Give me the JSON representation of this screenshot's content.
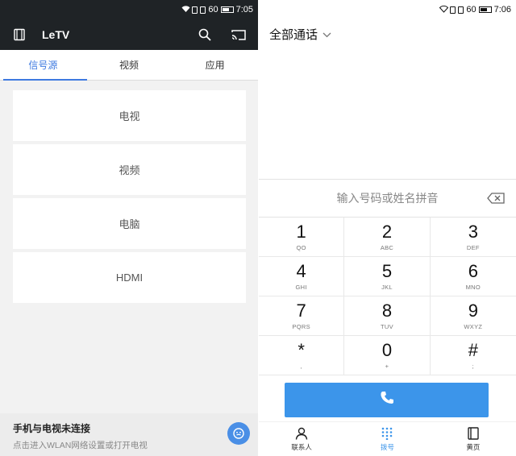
{
  "left": {
    "status": {
      "signal_label": "60",
      "time": "7:05"
    },
    "app_title": "LeTV",
    "tabs": [
      "信号源",
      "视频",
      "应用"
    ],
    "sources": [
      "电视",
      "视频",
      "电脑",
      "HDMI"
    ],
    "connect": {
      "title": "手机与电视未连接",
      "subtitle": "点击进入WLAN网络设置或打开电视"
    }
  },
  "right": {
    "status": {
      "signal_label": "60",
      "time": "7:06"
    },
    "filter_label": "全部通话",
    "number_placeholder": "输入号码或姓名拼音",
    "keys": [
      {
        "digit": "1",
        "letters": "QO"
      },
      {
        "digit": "2",
        "letters": "ABC"
      },
      {
        "digit": "3",
        "letters": "DEF"
      },
      {
        "digit": "4",
        "letters": "GHI"
      },
      {
        "digit": "5",
        "letters": "JKL"
      },
      {
        "digit": "6",
        "letters": "MNO"
      },
      {
        "digit": "7",
        "letters": "PQRS"
      },
      {
        "digit": "8",
        "letters": "TUV"
      },
      {
        "digit": "9",
        "letters": "WXYZ"
      },
      {
        "digit": "*",
        "letters": ","
      },
      {
        "digit": "0",
        "letters": "+"
      },
      {
        "digit": "#",
        "letters": ";"
      }
    ],
    "nav": [
      "联系人",
      "拨号",
      "黄页"
    ]
  },
  "colors": {
    "accent": "#3e7ae0",
    "call_button": "#3c95ea",
    "header_dark": "#1f2326"
  },
  "icons": [
    "device-icon",
    "search-icon",
    "cast-icon",
    "wifi-icon",
    "battery-icon",
    "chevron-down-icon",
    "backspace-icon",
    "phone-icon",
    "contacts-icon",
    "dialpad-icon",
    "yellow-pages-icon",
    "face-icon"
  ]
}
